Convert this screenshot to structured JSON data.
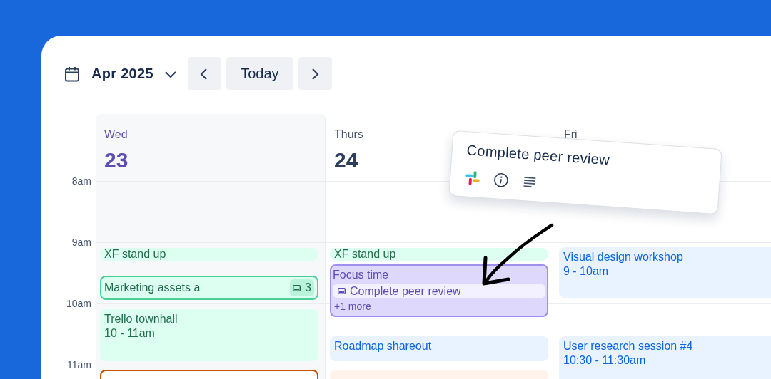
{
  "toolbar": {
    "month": "Apr 2025",
    "today_button": "Today"
  },
  "hours": [
    "8am",
    "9am",
    "10am",
    "11am"
  ],
  "days": [
    {
      "name": "Wed",
      "number": "23",
      "today": true,
      "events": [
        {
          "kind": "chip",
          "color": "#dcfff1",
          "title": "XF stand up"
        },
        {
          "kind": "outlined",
          "color": "#dcfff1",
          "title": "Marketing assets a",
          "badge": "3"
        },
        {
          "kind": "card",
          "color": "#dcfff1",
          "title": "Trello townhall",
          "time": "10 - 11am"
        },
        {
          "kind": "outlined",
          "color": "#ffffff"
        }
      ]
    },
    {
      "name": "Thurs",
      "number": "24",
      "today": false,
      "events": [
        {
          "kind": "chip",
          "color": "#dcfff1",
          "title": "XF stand up"
        },
        {
          "kind": "group",
          "color": "#dfd8fd",
          "title": "Focus time",
          "task": "Complete peer review",
          "more": "+1 more"
        },
        {
          "kind": "card",
          "color": "#e9f2ff",
          "title": "Roadmap shareout"
        },
        {
          "kind": "card",
          "color": "#fff3eb"
        }
      ]
    },
    {
      "name": "Fri",
      "today": false,
      "events": [
        {
          "kind": "card",
          "color": "#e9f2ff",
          "title": "Visual design workshop",
          "time": "9 - 10am"
        },
        {
          "kind": "card",
          "color": "#e9f2ff",
          "title": "User research session #4",
          "time": "10:30 - 11:30am"
        }
      ]
    }
  ],
  "popover": {
    "title": "Complete peer review"
  }
}
